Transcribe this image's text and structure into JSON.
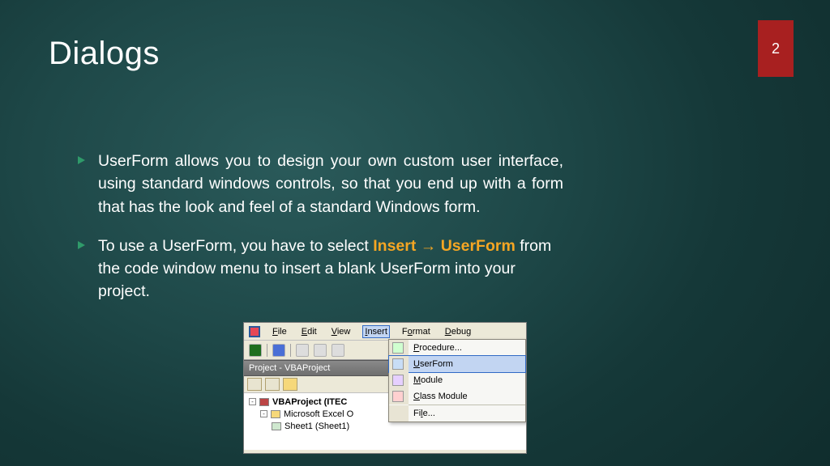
{
  "slide": {
    "title": "Dialogs",
    "page_number": "2"
  },
  "bullets": {
    "b1": "UserForm allows you to design your own custom user interface, using standard windows controls, so that you end up with a form that has the look and feel of a standard Windows form.",
    "b2a": "To use a UserForm, you have to select ",
    "b2_insert": "Insert",
    "b2_arrow": " → ",
    "b2_userform": "UserForm",
    "b2c": " from the code window menu to insert a blank UserForm into your project."
  },
  "vba": {
    "menubar": {
      "file": "File",
      "edit": "Edit",
      "view": "View",
      "insert": "Insert",
      "format": "Format",
      "debug": "Debug"
    },
    "pane_title": "Project - VBAProject",
    "tree": {
      "root": "VBAProject (ITEC",
      "excel_objects": "Microsoft Excel O",
      "sheet1": "Sheet1 (Sheet1)"
    },
    "dropdown": {
      "procedure": "Procedure...",
      "userform": "UserForm",
      "module": "Module",
      "class_module": "Class Module",
      "file": "File..."
    }
  },
  "colors": {
    "accent": "#f5a623",
    "badge": "#a82020"
  }
}
